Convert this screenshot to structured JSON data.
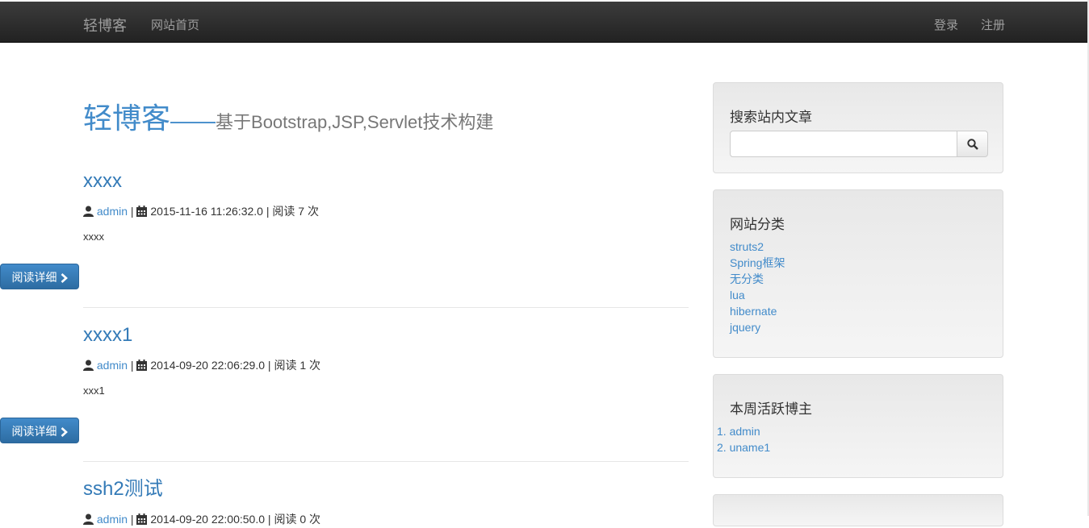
{
  "navbar": {
    "brand": "轻博客",
    "home": "网站首页",
    "login": "登录",
    "register": "注册"
  },
  "hero": {
    "title": "轻博客",
    "dash": "——",
    "subtitle": "基于Bootstrap,JSP,Servlet技术构建"
  },
  "posts": [
    {
      "title": "xxxx",
      "author": "admin",
      "date": "2015-11-16 11:26:32.0",
      "reads": "阅读 7 次",
      "summary": "xxxx",
      "button": "阅读详细"
    },
    {
      "title": "xxxx1",
      "author": "admin",
      "date": "2014-09-20 22:06:29.0",
      "reads": "阅读 1 次",
      "summary": "xxx1",
      "button": "阅读详细"
    },
    {
      "title": "ssh2测试",
      "author": "admin",
      "date": "2014-09-20 22:00:50.0",
      "reads": "阅读 0 次"
    }
  ],
  "meta_separator": "|",
  "sidebar": {
    "search": {
      "title": "搜索站内文章",
      "placeholder": ""
    },
    "categories": {
      "title": "网站分类",
      "items": [
        "struts2",
        "Spring框架",
        "无分类",
        "lua",
        "hibernate",
        "jquery"
      ]
    },
    "bloggers": {
      "title": "本周活跃博主",
      "items": [
        "1. admin",
        "2. uname1"
      ]
    }
  },
  "icons": {
    "user": "user-icon",
    "calendar": "calendar-icon",
    "chevron": "chevron-right-icon",
    "search": "search-icon"
  },
  "colors": {
    "link": "#428bca",
    "navbar": "#222222",
    "button": "#3071a9"
  }
}
